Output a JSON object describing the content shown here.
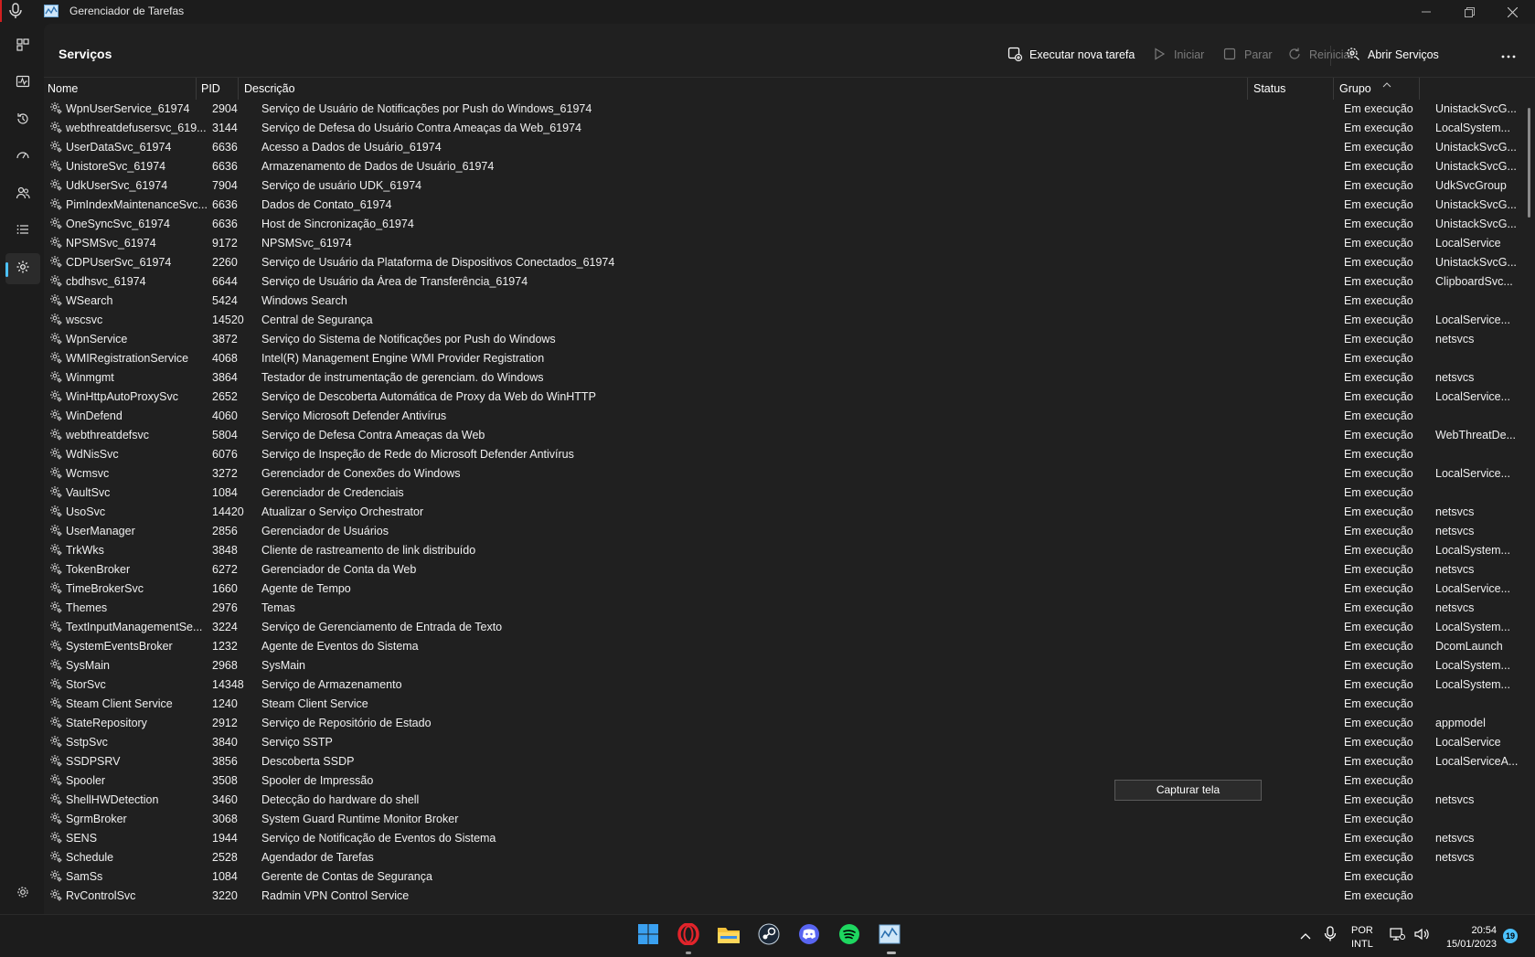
{
  "window": {
    "title": "Gerenciador de Tarefas"
  },
  "page": {
    "title": "Serviços"
  },
  "commands": {
    "new_task": "Executar nova tarefa",
    "start": "Iniciar",
    "stop": "Parar",
    "restart": "Reiniciar",
    "open_services": "Abrir Serviços"
  },
  "columns": {
    "name": "Nome",
    "pid": "PID",
    "description": "Descrição",
    "status": "Status",
    "group": "Grupo"
  },
  "services": [
    {
      "name": "WpnUserService_61974",
      "pid": "2904",
      "desc": "Serviço de Usuário de Notificações por Push do Windows_61974",
      "status": "Em execução",
      "group": "UnistackSvcG..."
    },
    {
      "name": "webthreatdefusersvc_619...",
      "pid": "3144",
      "desc": "Serviço de Defesa do Usuário Contra Ameaças da Web_61974",
      "status": "Em execução",
      "group": "LocalSystem..."
    },
    {
      "name": "UserDataSvc_61974",
      "pid": "6636",
      "desc": "Acesso a Dados de Usuário_61974",
      "status": "Em execução",
      "group": "UnistackSvcG..."
    },
    {
      "name": "UnistoreSvc_61974",
      "pid": "6636",
      "desc": "Armazenamento de Dados de Usuário_61974",
      "status": "Em execução",
      "group": "UnistackSvcG..."
    },
    {
      "name": "UdkUserSvc_61974",
      "pid": "7904",
      "desc": "Serviço de usuário UDK_61974",
      "status": "Em execução",
      "group": "UdkSvcGroup"
    },
    {
      "name": "PimIndexMaintenanceSvc...",
      "pid": "6636",
      "desc": "Dados de Contato_61974",
      "status": "Em execução",
      "group": "UnistackSvcG..."
    },
    {
      "name": "OneSyncSvc_61974",
      "pid": "6636",
      "desc": "Host de Sincronização_61974",
      "status": "Em execução",
      "group": "UnistackSvcG..."
    },
    {
      "name": "NPSMSvc_61974",
      "pid": "9172",
      "desc": "NPSMSvc_61974",
      "status": "Em execução",
      "group": "LocalService"
    },
    {
      "name": "CDPUserSvc_61974",
      "pid": "2260",
      "desc": "Serviço de Usuário da Plataforma de Dispositivos Conectados_61974",
      "status": "Em execução",
      "group": "UnistackSvcG..."
    },
    {
      "name": "cbdhsvc_61974",
      "pid": "6644",
      "desc": "Serviço de Usuário da Área de Transferência_61974",
      "status": "Em execução",
      "group": "ClipboardSvc..."
    },
    {
      "name": "WSearch",
      "pid": "5424",
      "desc": "Windows Search",
      "status": "Em execução",
      "group": ""
    },
    {
      "name": "wscsvc",
      "pid": "14520",
      "desc": "Central de Segurança",
      "status": "Em execução",
      "group": "LocalService..."
    },
    {
      "name": "WpnService",
      "pid": "3872",
      "desc": "Serviço do Sistema de Notificações por Push do Windows",
      "status": "Em execução",
      "group": "netsvcs"
    },
    {
      "name": "WMIRegistrationService",
      "pid": "4068",
      "desc": "Intel(R) Management Engine WMI Provider Registration",
      "status": "Em execução",
      "group": ""
    },
    {
      "name": "Winmgmt",
      "pid": "3864",
      "desc": "Testador de instrumentação de gerenciam. do Windows",
      "status": "Em execução",
      "group": "netsvcs"
    },
    {
      "name": "WinHttpAutoProxySvc",
      "pid": "2652",
      "desc": "Serviço de Descoberta Automática de Proxy da Web do WinHTTP",
      "status": "Em execução",
      "group": "LocalService..."
    },
    {
      "name": "WinDefend",
      "pid": "4060",
      "desc": "Serviço Microsoft Defender Antivírus",
      "status": "Em execução",
      "group": ""
    },
    {
      "name": "webthreatdefsvc",
      "pid": "5804",
      "desc": "Serviço de Defesa Contra Ameaças da Web",
      "status": "Em execução",
      "group": "WebThreatDe..."
    },
    {
      "name": "WdNisSvc",
      "pid": "6076",
      "desc": "Serviço de Inspeção de Rede do Microsoft Defender Antivírus",
      "status": "Em execução",
      "group": ""
    },
    {
      "name": "Wcmsvc",
      "pid": "3272",
      "desc": "Gerenciador de Conexões do Windows",
      "status": "Em execução",
      "group": "LocalService..."
    },
    {
      "name": "VaultSvc",
      "pid": "1084",
      "desc": "Gerenciador de Credenciais",
      "status": "Em execução",
      "group": ""
    },
    {
      "name": "UsoSvc",
      "pid": "14420",
      "desc": "Atualizar o Serviço Orchestrator",
      "status": "Em execução",
      "group": "netsvcs"
    },
    {
      "name": "UserManager",
      "pid": "2856",
      "desc": "Gerenciador de Usuários",
      "status": "Em execução",
      "group": "netsvcs"
    },
    {
      "name": "TrkWks",
      "pid": "3848",
      "desc": "Cliente de rastreamento de link distribuído",
      "status": "Em execução",
      "group": "LocalSystem..."
    },
    {
      "name": "TokenBroker",
      "pid": "6272",
      "desc": "Gerenciador de Conta da Web",
      "status": "Em execução",
      "group": "netsvcs"
    },
    {
      "name": "TimeBrokerSvc",
      "pid": "1660",
      "desc": "Agente de Tempo",
      "status": "Em execução",
      "group": "LocalService..."
    },
    {
      "name": "Themes",
      "pid": "2976",
      "desc": "Temas",
      "status": "Em execução",
      "group": "netsvcs"
    },
    {
      "name": "TextInputManagementSe...",
      "pid": "3224",
      "desc": "Serviço de Gerenciamento de Entrada de Texto",
      "status": "Em execução",
      "group": "LocalSystem..."
    },
    {
      "name": "SystemEventsBroker",
      "pid": "1232",
      "desc": "Agente de Eventos do Sistema",
      "status": "Em execução",
      "group": "DcomLaunch"
    },
    {
      "name": "SysMain",
      "pid": "2968",
      "desc": "SysMain",
      "status": "Em execução",
      "group": "LocalSystem..."
    },
    {
      "name": "StorSvc",
      "pid": "14348",
      "desc": "Serviço de Armazenamento",
      "status": "Em execução",
      "group": "LocalSystem..."
    },
    {
      "name": "Steam Client Service",
      "pid": "1240",
      "desc": "Steam Client Service",
      "status": "Em execução",
      "group": ""
    },
    {
      "name": "StateRepository",
      "pid": "2912",
      "desc": "Serviço de Repositório de Estado",
      "status": "Em execução",
      "group": "appmodel"
    },
    {
      "name": "SstpSvc",
      "pid": "3840",
      "desc": "Serviço SSTP",
      "status": "Em execução",
      "group": "LocalService"
    },
    {
      "name": "SSDPSRV",
      "pid": "3856",
      "desc": "Descoberta SSDP",
      "status": "Em execução",
      "group": "LocalServiceA..."
    },
    {
      "name": "Spooler",
      "pid": "3508",
      "desc": "Spooler de Impressão",
      "status": "Em execução",
      "group": ""
    },
    {
      "name": "ShellHWDetection",
      "pid": "3460",
      "desc": "Detecção do hardware do shell",
      "status": "Em execução",
      "group": "netsvcs"
    },
    {
      "name": "SgrmBroker",
      "pid": "3068",
      "desc": "System Guard Runtime Monitor Broker",
      "status": "Em execução",
      "group": ""
    },
    {
      "name": "SENS",
      "pid": "1944",
      "desc": "Serviço de Notificação de Eventos do Sistema",
      "status": "Em execução",
      "group": "netsvcs"
    },
    {
      "name": "Schedule",
      "pid": "2528",
      "desc": "Agendador de Tarefas",
      "status": "Em execução",
      "group": "netsvcs"
    },
    {
      "name": "SamSs",
      "pid": "1084",
      "desc": "Gerente de Contas de Segurança",
      "status": "Em execução",
      "group": ""
    },
    {
      "name": "RvControlSvc",
      "pid": "3220",
      "desc": "Radmin VPN Control Service",
      "status": "Em execução",
      "group": ""
    }
  ],
  "tooltip": {
    "text": "Capturar tela"
  },
  "taskbar": {
    "language": "POR",
    "layout": "INTL",
    "time": "20:54",
    "date": "15/01/2023",
    "notifications": "19"
  },
  "colors": {
    "accent": "#4cc2ff",
    "background": "#202020",
    "nav_background": "#1c1c1c"
  }
}
